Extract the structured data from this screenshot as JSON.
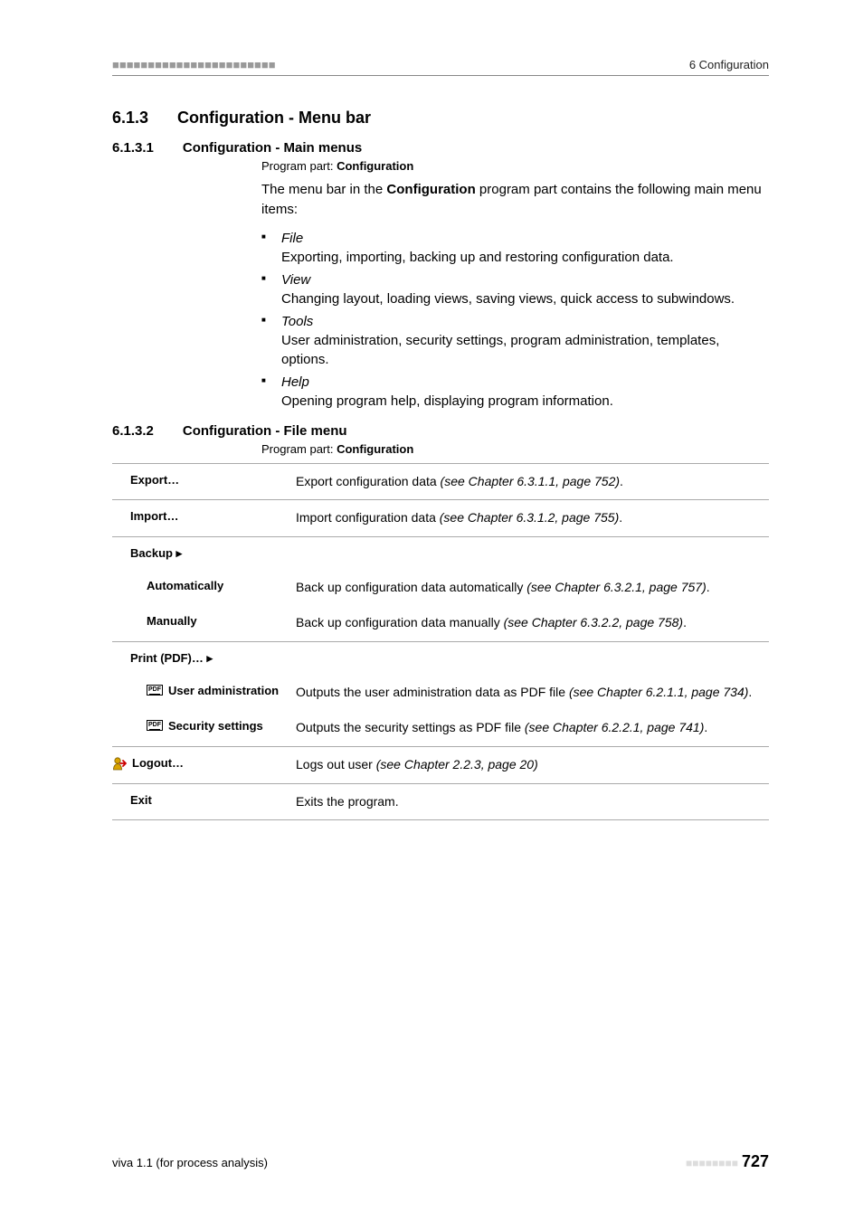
{
  "header": {
    "left_decor": "■■■■■■■■■■■■■■■■■■■■■■■",
    "right": "6 Configuration"
  },
  "sec1": {
    "num": "6.1.3",
    "title": "Configuration - Menu bar"
  },
  "sub1": {
    "num": "6.1.3.1",
    "title": "Configuration - Main menus",
    "prog_label": "Program part: ",
    "prog_val": "Configuration",
    "para_pre": "The menu bar in the ",
    "para_strong": "Configuration",
    "para_post": " program part contains the following main menu items:",
    "items": [
      {
        "name": "File",
        "desc": "Exporting, importing, backing up and restoring configuration data."
      },
      {
        "name": "View",
        "desc": "Changing layout, loading views, saving views, quick access to subwindows."
      },
      {
        "name": "Tools",
        "desc": "User administration, security settings, program administration, templates, options."
      },
      {
        "name": "Help",
        "desc": "Opening program help, displaying program information."
      }
    ]
  },
  "sub2": {
    "num": "6.1.3.2",
    "title": "Configuration - File menu",
    "prog_label": "Program part: ",
    "prog_val": "Configuration",
    "rows": {
      "export": {
        "label": "Export…",
        "desc_pre": "Export configuration data ",
        "desc_ital": "(see Chapter 6.3.1.1, page 752)",
        "desc_post": "."
      },
      "import": {
        "label": "Import…",
        "desc_pre": "Import configuration data ",
        "desc_ital": "(see Chapter 6.3.1.2, page 755)",
        "desc_post": "."
      },
      "backup": {
        "label": "Backup ▸"
      },
      "auto": {
        "label": "Automatically",
        "desc_pre": "Back up configuration data automatically ",
        "desc_ital": "(see Chapter 6.3.2.1, page 757)",
        "desc_post": "."
      },
      "manual": {
        "label": "Manually",
        "desc_pre": "Back up configuration data manually ",
        "desc_ital": "(see Chapter 6.3.2.2, page 758)",
        "desc_post": "."
      },
      "printpdf": {
        "label": "Print (PDF)… ▸"
      },
      "useradmin": {
        "label": "User administration",
        "desc_pre": "Outputs the user administration data as PDF file ",
        "desc_ital": "(see Chapter 6.2.1.1, page 734)",
        "desc_post": "."
      },
      "secset": {
        "label": "Security settings",
        "desc_pre": "Outputs the security settings as PDF file ",
        "desc_ital": "(see Chapter 6.2.2.1, page 741)",
        "desc_post": "."
      },
      "logout": {
        "label": "Logout…",
        "desc_pre": "Logs out user ",
        "desc_ital": "(see Chapter 2.2.3, page 20)",
        "desc_post": ""
      },
      "exit": {
        "label": "Exit",
        "desc": "Exits the program."
      }
    }
  },
  "icons": {
    "pdf_text": "PDF"
  },
  "footer": {
    "left": "viva 1.1 (for process analysis)",
    "dots": "■■■■■■■■",
    "page": "727"
  }
}
